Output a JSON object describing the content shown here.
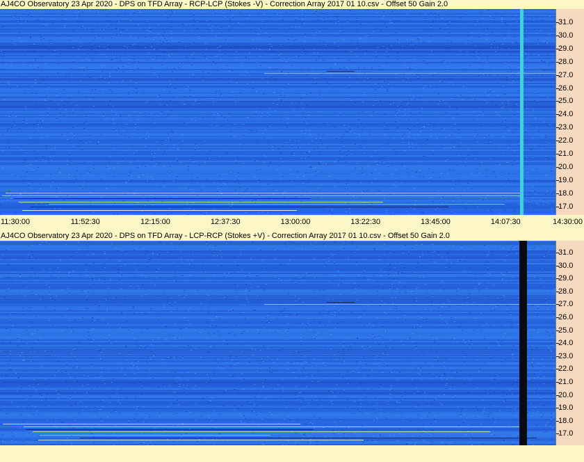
{
  "panels": [
    {
      "title": "AJ4CO Observatory 23 Apr 2020  -  DPS on TFD Array  -  RCP-LCP (Stokes -V)  -  Correction Array 2017 01 10.csv  -  Offset 50  Gain 2.0",
      "freq_labels": [
        "31.0",
        "30.0",
        "29.0",
        "28.0",
        "27.0",
        "26.0",
        "25.0",
        "24.0",
        "23.0",
        "22.0",
        "21.0",
        "20.0",
        "19.0",
        "18.0",
        "17.0"
      ],
      "interference_column_color": "#3fd2d8"
    },
    {
      "title": "AJ4CO Observatory 23 Apr 2020  -  DPS on TFD Array  -  LCP-RCP (Stokes +V)  -  Correction Array 2017 01 10.csv  -  Offset 50  Gain 2.0",
      "freq_labels": [
        "31.0",
        "30.0",
        "29.0",
        "28.0",
        "27.0",
        "26.0",
        "25.0",
        "24.0",
        "23.0",
        "22.0",
        "21.0",
        "20.0",
        "19.0",
        "18.0",
        "17.0"
      ],
      "interference_column_color": "#0a0a12"
    }
  ],
  "time_labels": [
    "11:30:00",
    "11:52:30",
    "12:15:00",
    "12:37:30",
    "13:00:00",
    "13:22:30",
    "13:45:00",
    "14:07:30",
    "14:30:00"
  ],
  "colors": {
    "background": "#fdf6c6",
    "axis_panel": "#f7d9c0",
    "spectrogram_base": "#2a6ee6",
    "spectrogram_dark": "#1a48c8",
    "spectrogram_light": "#3c88ee"
  }
}
